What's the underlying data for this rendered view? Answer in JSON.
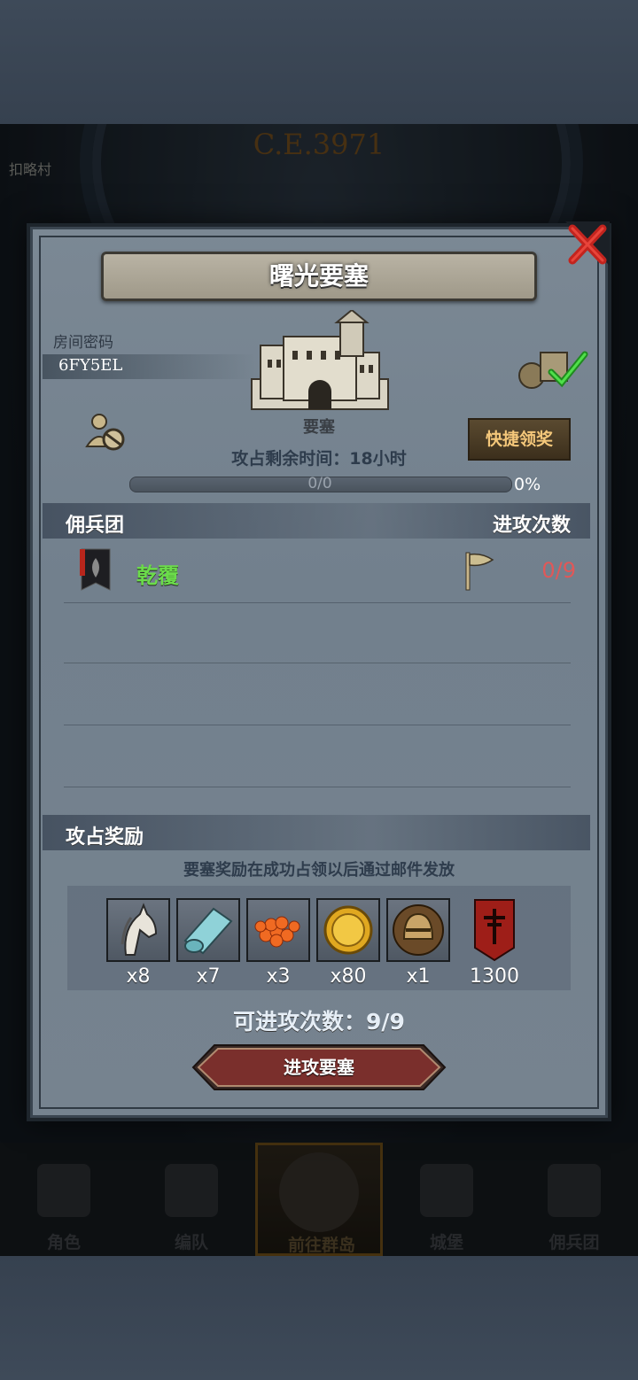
{
  "background": {
    "year": "C.E.3971",
    "village_label": "扣略村"
  },
  "bottom_nav": {
    "items": [
      {
        "label": "角色",
        "icon": "knight-icon"
      },
      {
        "label": "编队",
        "icon": "team-helmet-icon"
      },
      {
        "label": "前往群岛",
        "icon": "island-compass-icon",
        "active": true
      },
      {
        "label": "城堡",
        "icon": "castle-icon"
      },
      {
        "label": "佣兵团",
        "icon": "mercenary-ship-icon"
      }
    ]
  },
  "dialog": {
    "title": "曙光要塞",
    "room": {
      "label": "房间密码",
      "code": "6FY5EL"
    },
    "building": {
      "name": "要塞",
      "icon": "fortress-icon"
    },
    "quick_claim_button": "快捷领奖",
    "remaining_time": "攻占剩余时间：18小时",
    "progress": {
      "text": "0/0",
      "percent_label": "0%",
      "value": 0
    },
    "mercenary_section": {
      "title": "佣兵团",
      "right_title": "进攻次数",
      "rows": [
        {
          "name": "乾覆",
          "attacks": "0/9",
          "banner_icon": "guild-banner-icon",
          "flag_icon": "flag-icon"
        }
      ]
    },
    "reward_section": {
      "title": "攻占奖励",
      "note": "要塞奖励在成功占领以后通过邮件发放",
      "items": [
        {
          "icon": "horse-icon",
          "count": "x8"
        },
        {
          "icon": "cloth-roll-icon",
          "count": "x7"
        },
        {
          "icon": "caviar-icon",
          "count": "x3"
        },
        {
          "icon": "gold-coin-icon",
          "count": "x80"
        },
        {
          "icon": "knight-helmet-icon",
          "count": "x1"
        },
        {
          "icon": "guild-honor-banner-icon",
          "count": "1300"
        }
      ]
    },
    "attack_count": "可进攻次数：9/9",
    "attack_button": "进攻要塞"
  },
  "colors": {
    "merc_name": "#6bdc4a",
    "attacks": "#e05858",
    "quick_button_text": "#f4c77a",
    "attack_button": "#7a2f2c"
  }
}
